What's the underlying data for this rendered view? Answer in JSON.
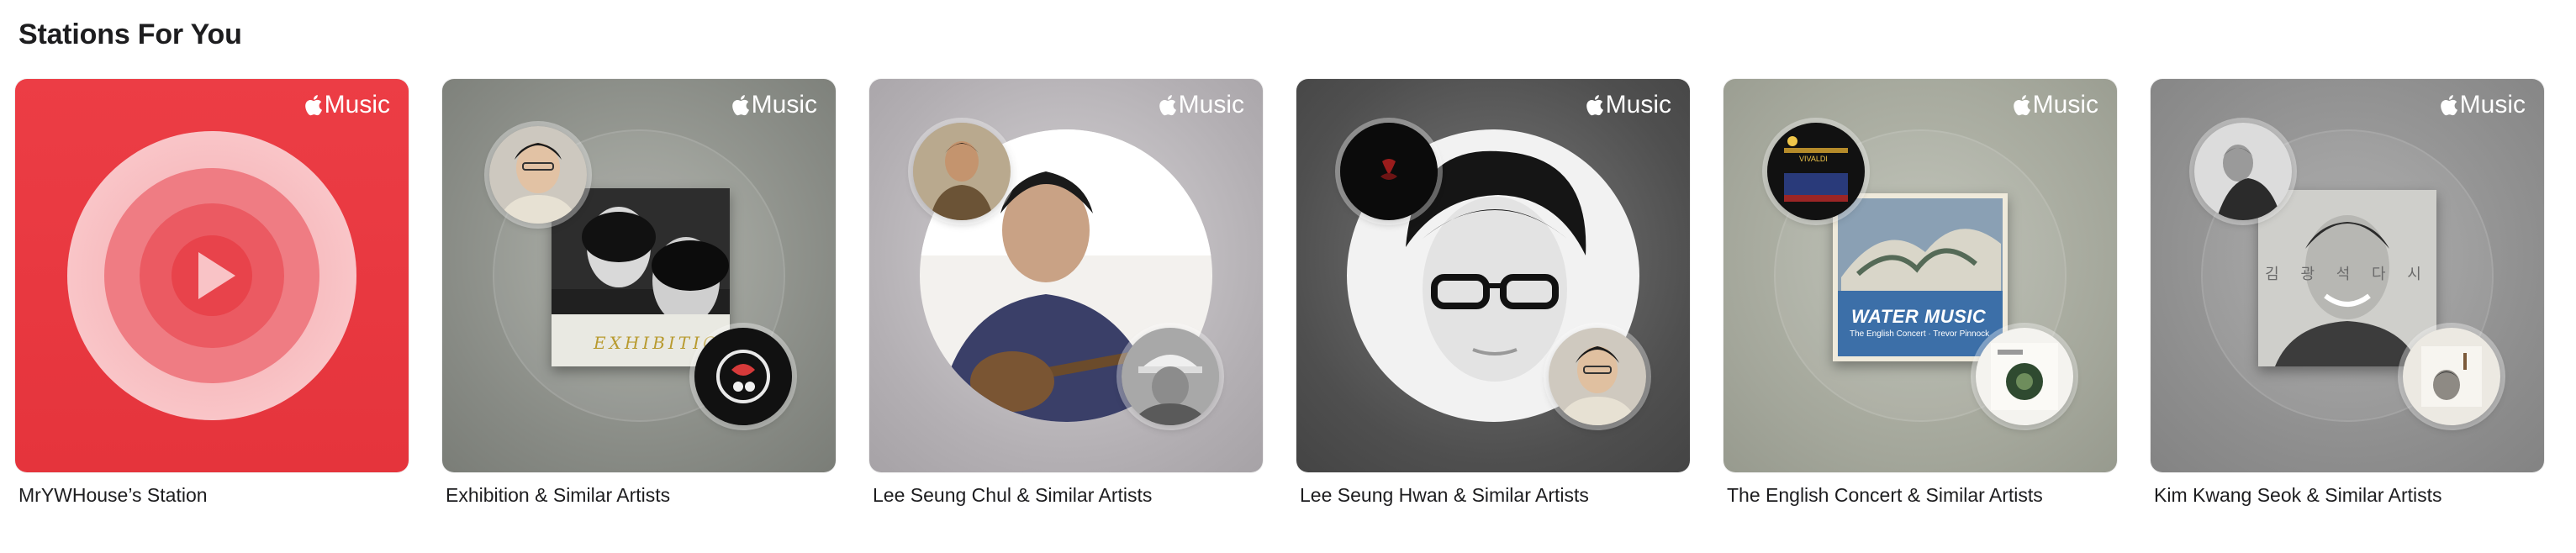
{
  "section": {
    "title": "Stations For You"
  },
  "brand": {
    "label": "Music",
    "color": "#ffffff"
  },
  "stations": [
    {
      "caption": "MrYWHouse’s Station",
      "bg": "#e8383f"
    },
    {
      "caption": "Exhibition & Similar Artists",
      "bg": "#8e918b",
      "cover_text": "EXHIBITION"
    },
    {
      "caption": "Lee Seung Chul & Similar Artists",
      "bg": "#b9b6ba"
    },
    {
      "caption": "Lee Seung Hwan & Similar Artists",
      "bg": "#565656"
    },
    {
      "caption": "The English Concert & Similar Artists",
      "bg": "#a7aa9e",
      "cover_title": "WATER MUSIC",
      "cover_sub": "The English Concert · Trevor Pinnock",
      "badge_text": "VIVALDI"
    },
    {
      "caption": "Kim Kwang Seok & Similar Artists",
      "bg": "#929292",
      "cover_text": "김 광 석 다 시"
    }
  ]
}
